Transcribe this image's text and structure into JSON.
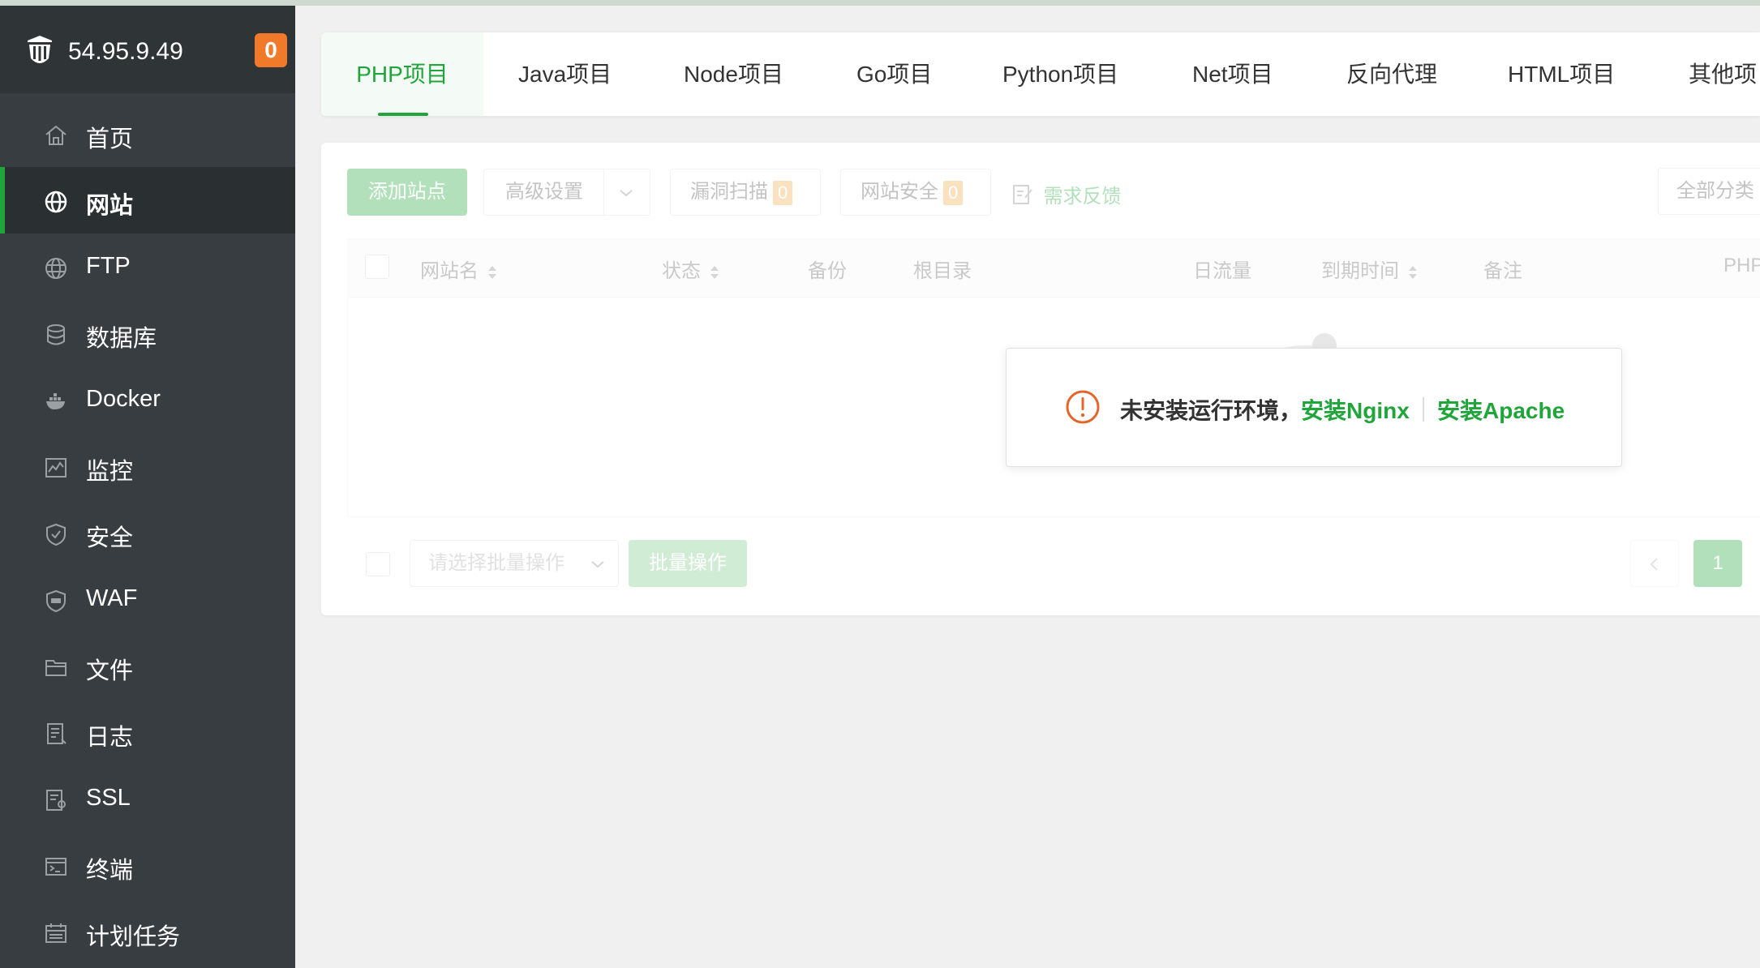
{
  "server": {
    "ip": "54.95.9.49",
    "notification_count": "0"
  },
  "sidebar": {
    "items": [
      {
        "label": "首页",
        "icon": "home-icon"
      },
      {
        "label": "网站",
        "icon": "globe-icon",
        "active": true
      },
      {
        "label": "FTP",
        "icon": "ftp-globe-icon"
      },
      {
        "label": "数据库",
        "icon": "database-icon"
      },
      {
        "label": "Docker",
        "icon": "docker-icon"
      },
      {
        "label": "监控",
        "icon": "monitor-icon"
      },
      {
        "label": "安全",
        "icon": "shield-icon"
      },
      {
        "label": "WAF",
        "icon": "waf-shield-icon"
      },
      {
        "label": "文件",
        "icon": "folder-icon"
      },
      {
        "label": "日志",
        "icon": "log-icon"
      },
      {
        "label": "SSL",
        "icon": "certificate-icon"
      },
      {
        "label": "终端",
        "icon": "terminal-icon"
      },
      {
        "label": "计划任务",
        "icon": "calendar-icon"
      }
    ]
  },
  "tabs": [
    "PHP项目",
    "Java项目",
    "Node项目",
    "Go项目",
    "Python项目",
    "Net项目",
    "反向代理",
    "HTML项目",
    "其他项"
  ],
  "toolbar": {
    "add_site": "添加站点",
    "advanced_settings": "高级设置",
    "vuln_scan": "漏洞扫描",
    "vuln_scan_count": "0",
    "site_security": "网站安全",
    "site_security_count": "0",
    "feedback": "需求反馈",
    "category": "全部分类"
  },
  "table": {
    "columns": [
      "网站名",
      "状态",
      "备份",
      "根目录",
      "日流量",
      "到期时间",
      "备注",
      "PHP"
    ]
  },
  "alert": {
    "message": "未安装运行环境，",
    "install_nginx": "安装Nginx",
    "install_apache": "安装Apache"
  },
  "footer": {
    "batch_placeholder": "请选择批量操作",
    "batch_button": "批量操作",
    "current_page": "1"
  },
  "colors": {
    "accent": "#20a53a",
    "sidebar_bg": "#373d41",
    "badge": "#f0792a",
    "warning": "#e5652b"
  }
}
